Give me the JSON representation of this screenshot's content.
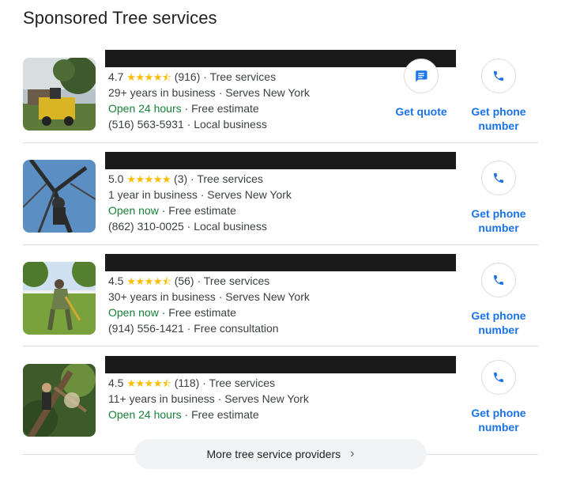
{
  "heading": "Sponsored Tree services",
  "listings": [
    {
      "rating": "4.7",
      "stars": "★★★★⯪",
      "reviews": "(916)",
      "category": "Tree services",
      "experience": "29+ years in business",
      "serves": "Serves New York",
      "hours": "Open 24 hours",
      "offer": "Free estimate",
      "phone": "(516) 563-5931",
      "tag": "Local business",
      "has_quote": true,
      "quote_label": "Get quote",
      "phone_label": "Get phone number"
    },
    {
      "rating": "5.0",
      "stars": "★★★★★",
      "reviews": "(3)",
      "category": "Tree services",
      "experience": "1 year in business",
      "serves": "Serves New York",
      "hours": "Open now",
      "offer": "Free estimate",
      "phone": "(862) 310-0025",
      "tag": "Local business",
      "phone_label": "Get phone number"
    },
    {
      "rating": "4.5",
      "stars": "★★★★⯪",
      "reviews": "(56)",
      "category": "Tree services",
      "experience": "30+ years in business",
      "serves": "Serves New York",
      "hours": "Open now",
      "offer": "Free estimate",
      "phone": "(914) 556-1421",
      "tag": "Free consultation",
      "phone_label": "Get phone number"
    },
    {
      "rating": "4.5",
      "stars": "★★★★⯪",
      "reviews": "(118)",
      "category": "Tree services",
      "experience": "11+ years in business",
      "serves": "Serves New York",
      "hours": "Open 24 hours",
      "offer": "Free estimate",
      "phone_label": "Get phone number"
    }
  ],
  "more_button": {
    "label": "More tree service providers",
    "chevron": "›"
  },
  "colors": {
    "accent": "#1a73e8",
    "open": "#188038",
    "star": "#fbbc04"
  }
}
